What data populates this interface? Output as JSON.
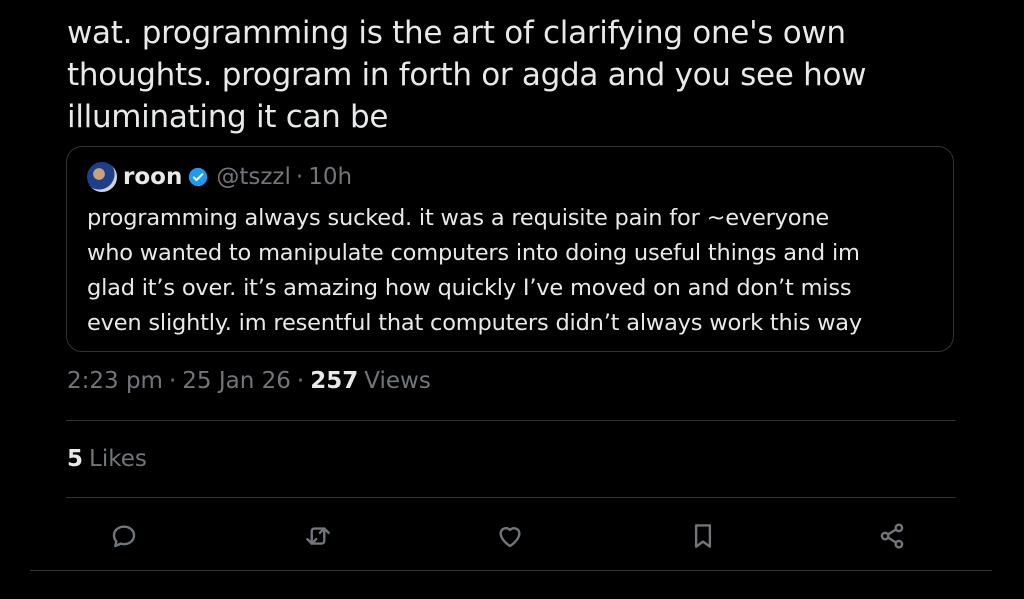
{
  "tweet": {
    "text_lines": [
      "wat. programming is the art of clarifying one's own",
      "thoughts. program in forth or agda and you see how",
      "illuminating it can be"
    ]
  },
  "quote": {
    "name": "roon",
    "handle": "@tszzl",
    "separator": "·",
    "time": "10h",
    "text_lines": [
      "programming always sucked. it was a requisite pain for ~everyone",
      "who wanted to manipulate computers into doing useful things and im",
      "glad it’s over. it’s amazing how quickly I’ve moved on and don’t miss",
      "even slightly. im resentful that computers didn’t always work this way"
    ]
  },
  "meta": {
    "time": "2:23 pm",
    "dot": "·",
    "date": "25 Jan 26",
    "views_count": "257",
    "views_label": "Views"
  },
  "likes": {
    "count": "5",
    "label": "Likes"
  },
  "actions": {
    "reply": "reply-icon",
    "repost": "repost-icon",
    "like": "heart-icon",
    "bookmark": "bookmark-icon",
    "share": "share-icon"
  },
  "colors": {
    "background": "#000000",
    "text": "#e7e9ea",
    "muted": "#71767b",
    "border": "#2f3336",
    "verified": "#1d9bf0"
  }
}
